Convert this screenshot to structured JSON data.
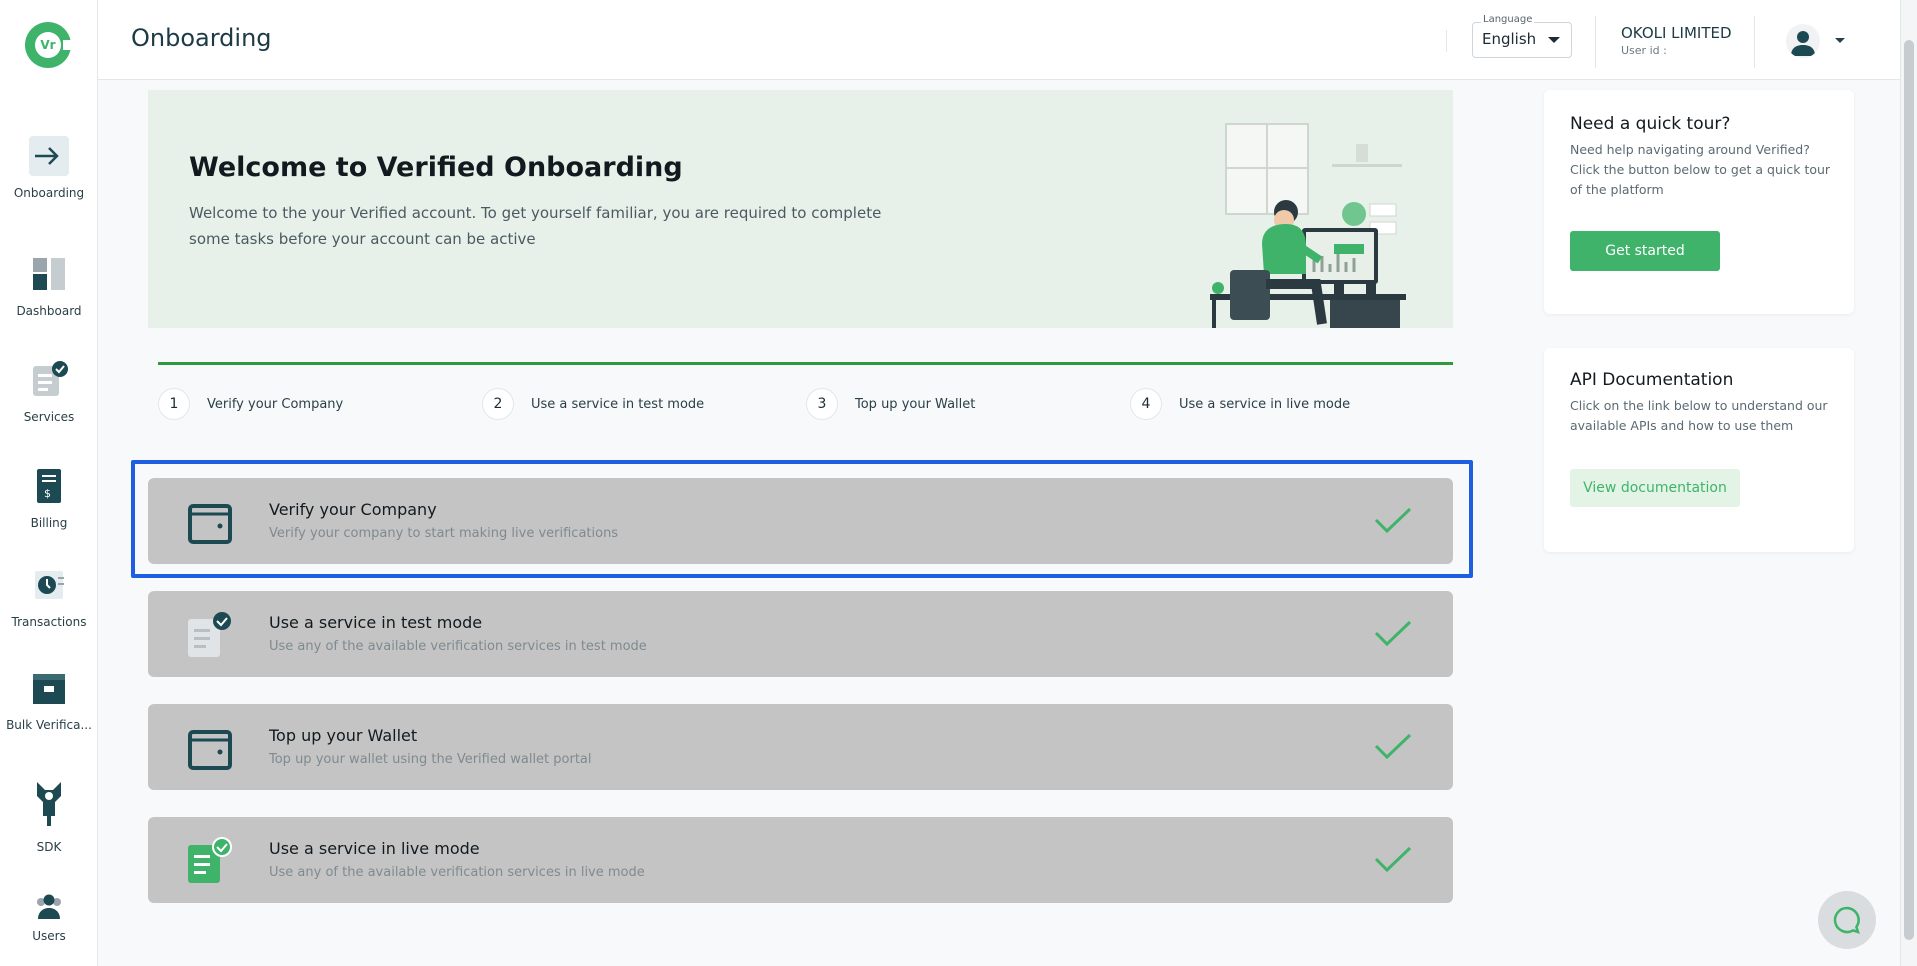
{
  "app": {
    "logo_text": "Vr",
    "brand_color": "#3fb36a"
  },
  "header": {
    "title": "Onboarding",
    "language_caption": "Language",
    "language_value": "English",
    "company_name": "OKOLI LIMITED",
    "user_id_label": "User id :"
  },
  "sidebar": {
    "items": [
      {
        "label": "Onboarding",
        "icon": "arrow-right-icon"
      },
      {
        "label": "Dashboard",
        "icon": "dashboard-icon"
      },
      {
        "label": "Services",
        "icon": "services-icon"
      },
      {
        "label": "Billing",
        "icon": "billing-icon"
      },
      {
        "label": "Transactions",
        "icon": "transactions-icon"
      },
      {
        "label": "Bulk Verifica...",
        "icon": "bulk-verification-icon"
      },
      {
        "label": "SDK",
        "icon": "sdk-icon"
      },
      {
        "label": "Users",
        "icon": "users-icon"
      }
    ]
  },
  "hero": {
    "title": "Welcome to Verified Onboarding",
    "description": "Welcome to the your Verified account. To get yourself familiar, you are required to complete some tasks before your account can be active"
  },
  "stepper": {
    "steps": [
      {
        "number": "1",
        "label": "Verify your Company"
      },
      {
        "number": "2",
        "label": "Use a service in test mode"
      },
      {
        "number": "3",
        "label": "Top up your Wallet"
      },
      {
        "number": "4",
        "label": "Use a service in live mode"
      }
    ]
  },
  "tasks": [
    {
      "title": "Verify your Company",
      "subtitle": "Verify your company to start making live verifications",
      "icon": "wallet-icon",
      "status": "completed"
    },
    {
      "title": "Use a service in test mode",
      "subtitle": "Use any of the available verification services in test mode",
      "icon": "test-service-icon",
      "status": "completed"
    },
    {
      "title": "Top up your Wallet",
      "subtitle": "Top up your wallet using the Verified wallet portal",
      "icon": "wallet-icon",
      "status": "completed"
    },
    {
      "title": "Use a service in live mode",
      "subtitle": "Use any of the available verification services in live mode",
      "icon": "live-service-icon",
      "status": "completed"
    }
  ],
  "quick_tour": {
    "title": "Need a quick tour?",
    "description": "Need help navigating around Verified? Click the button below to get a quick tour of the platform",
    "button_label": "Get started"
  },
  "api_docs": {
    "title": "API Documentation",
    "description": "Click on the link below to understand our available APIs and how to use them",
    "button_label": "View documentation"
  },
  "colors": {
    "accent": "#3fb36a",
    "dark": "#1d4a52",
    "task_bg": "#c4c4c4",
    "highlight": "#1d5fe0"
  }
}
